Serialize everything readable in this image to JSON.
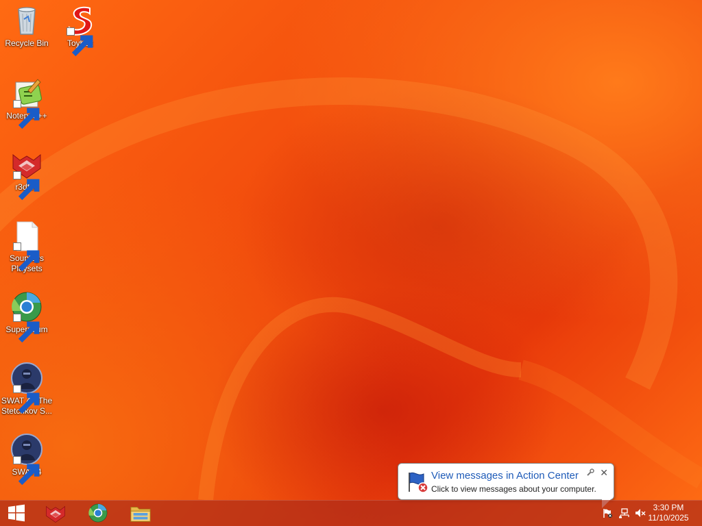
{
  "desktop": {
    "icons": [
      {
        "label": "Recycle Bin",
        "icon": "recycle-bin-icon"
      },
      {
        "label": "Toybox",
        "icon": "toybox-icon"
      },
      {
        "label": "Notepad++",
        "icon": "notepad-plus-plus-icon"
      },
      {
        "label": "r3dfox",
        "icon": "r3dfox-icon"
      },
      {
        "label": "Souptoys Playsets",
        "icon": "file-icon"
      },
      {
        "label": "Supermium",
        "icon": "supermium-icon"
      },
      {
        "label": "SWAT 4 - The Stetchkov S...",
        "icon": "swat4-icon"
      },
      {
        "label": "SWAT 4",
        "icon": "swat4-icon"
      }
    ]
  },
  "taskbar": {
    "buttons": [
      {
        "name": "start-button",
        "icon": "windows-logo-icon"
      },
      {
        "name": "taskbar-r3dfox",
        "icon": "r3dfox-icon"
      },
      {
        "name": "taskbar-supermium",
        "icon": "supermium-icon"
      },
      {
        "name": "taskbar-file-explorer",
        "icon": "folder-icon"
      }
    ],
    "tray": {
      "time": "3:30 PM",
      "date": "11/10/2025"
    }
  },
  "notification": {
    "title": "View messages in Action Center",
    "text": "Click to view messages about your computer."
  },
  "colors": {
    "wallpaper_primary": "#f0480c",
    "link_blue": "#1e5bb8"
  }
}
